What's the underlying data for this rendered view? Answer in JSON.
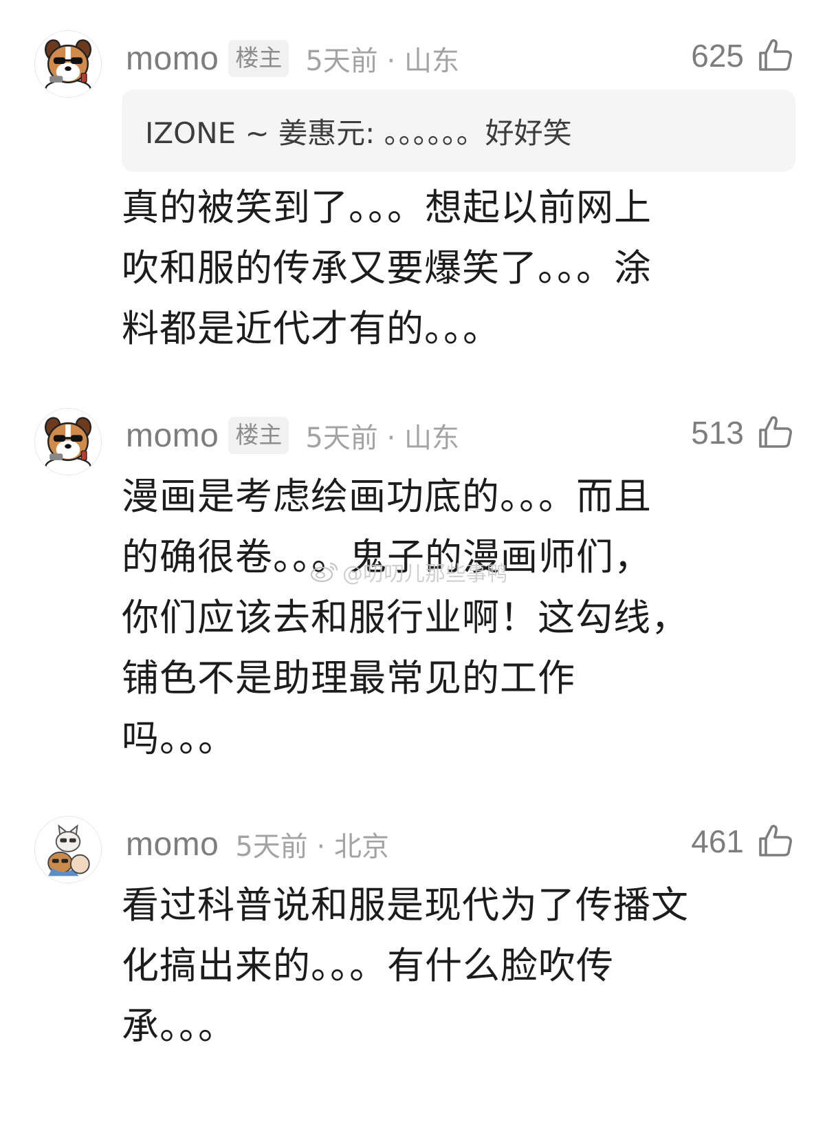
{
  "comments": [
    {
      "username": "momo",
      "badge": "楼主",
      "time_location": "5天前 · 山东",
      "likes": "625",
      "quote": "IZONE ~ 姜惠元: 。。。。。。好好笑",
      "lines": [
        "真的被笑到了。。。想起以前网上",
        "吹和服的传承又要爆笑了。。。涂",
        "料都是近代才有的。。。"
      ],
      "avatar_icon": "dog-with-sunglasses-avatar",
      "like_icon": "thumbs-up-icon"
    },
    {
      "username": "momo",
      "badge": "楼主",
      "time_location": "5天前 · 山东",
      "likes": "513",
      "lines": [
        "漫画是考虑绘画功底的。。。而且",
        "的确很卷。。。鬼子的漫画师们，",
        "你们应该去和服行业啊！这勾线，",
        "铺色不是助理最常见的工作",
        "吗。。。"
      ],
      "avatar_icon": "dog-with-sunglasses-avatar",
      "like_icon": "thumbs-up-icon"
    },
    {
      "username": "momo",
      "time_location": "5天前 · 北京",
      "likes": "461",
      "lines": [
        "看过科普说和服是现代为了传播文",
        "化搞出来的。。。有什么脸吹传",
        "承。。。"
      ],
      "avatar_icon": "cat-and-dog-avatar",
      "like_icon": "thumbs-up-icon"
    }
  ],
  "watermark": {
    "text": "@叨叨儿那些事鸭",
    "icon": "weibo-icon"
  }
}
